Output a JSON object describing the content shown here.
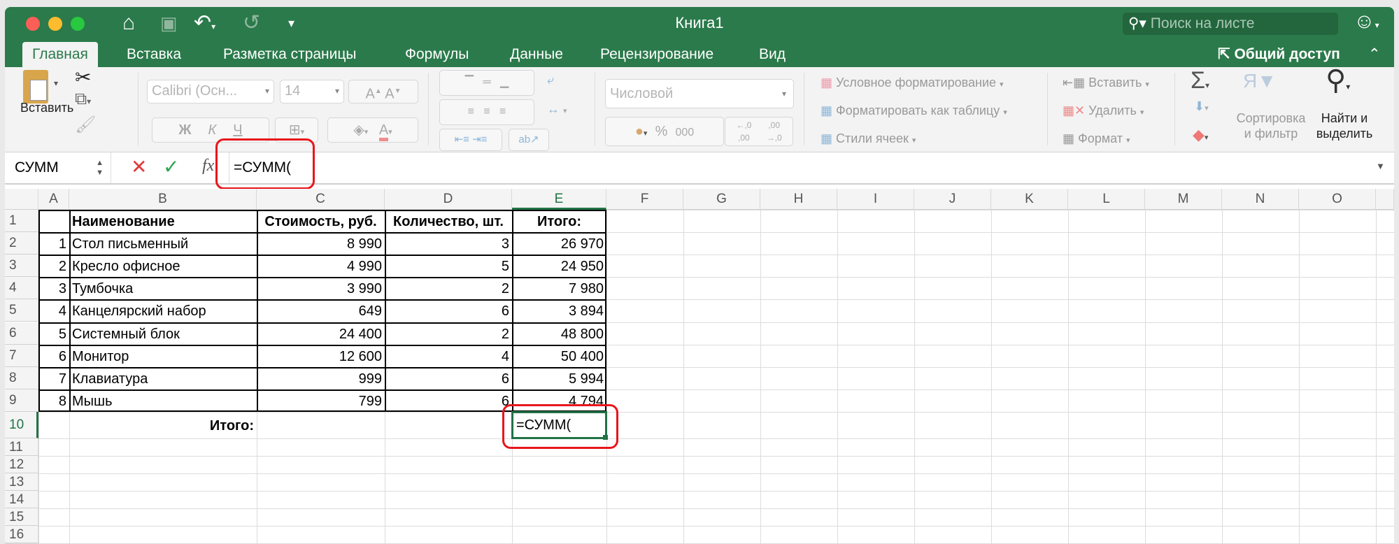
{
  "window": {
    "title": "Книга1",
    "search_placeholder": "Поиск на листе"
  },
  "tabs": [
    "Главная",
    "Вставка",
    "Разметка страницы",
    "Формулы",
    "Данные",
    "Рецензирование",
    "Вид"
  ],
  "share_label": "Общий доступ",
  "ribbon": {
    "paste_label": "Вставить",
    "font_name": "Calibri (Осн...",
    "font_size": "14",
    "bold": "Ж",
    "italic": "К",
    "underline": "Ч",
    "number_format": "Числовой",
    "percent": "%",
    "thousands": "000",
    "dec_increase": "←,0 ,00",
    "dec_decrease": ",00 →,0",
    "conditional_formatting": "Условное форматирование",
    "format_as_table": "Форматировать как таблицу",
    "cell_styles": "Стили ячеек",
    "insert": "Вставить",
    "delete": "Удалить",
    "format": "Формат",
    "sort_filter_1": "Сортировка",
    "sort_filter_2": "и фильтр",
    "find_select_1": "Найти и",
    "find_select_2": "выделить"
  },
  "formula_bar": {
    "name_box": "СУММ",
    "formula": "=СУММ("
  },
  "sheet": {
    "columns": [
      "A",
      "B",
      "C",
      "D",
      "E",
      "F",
      "G",
      "H",
      "I",
      "J",
      "K",
      "L",
      "M",
      "N",
      "O"
    ],
    "row_numbers": [
      "1",
      "2",
      "3",
      "4",
      "5",
      "6",
      "7",
      "8",
      "9",
      "10",
      "11",
      "12",
      "13",
      "14",
      "15",
      "16"
    ],
    "headers": [
      "",
      "Наименование",
      "Стоимость, руб.",
      "Количество, шт.",
      "Итого:"
    ],
    "rows": [
      [
        "1",
        "Стол письменный",
        "8 990",
        "3",
        "26 970"
      ],
      [
        "2",
        "Кресло офисное",
        "4 990",
        "5",
        "24 950"
      ],
      [
        "3",
        "Тумбочка",
        "3 990",
        "2",
        "7 980"
      ],
      [
        "4",
        "Канцелярский набор",
        "649",
        "6",
        "3 894"
      ],
      [
        "5",
        "Системный блок",
        "24 400",
        "2",
        "48 800"
      ],
      [
        "6",
        "Монитор",
        "12 600",
        "4",
        "50 400"
      ],
      [
        "7",
        "Клавиатура",
        "999",
        "6",
        "5 994"
      ],
      [
        "8",
        "Мышь",
        "799",
        "6",
        "4 794"
      ]
    ],
    "total_label": "Итого:",
    "active_cell_value": "=СУММ("
  },
  "colors": {
    "brand": "#2b7a4b",
    "highlight": "#e8161b",
    "selection": "#217346"
  }
}
